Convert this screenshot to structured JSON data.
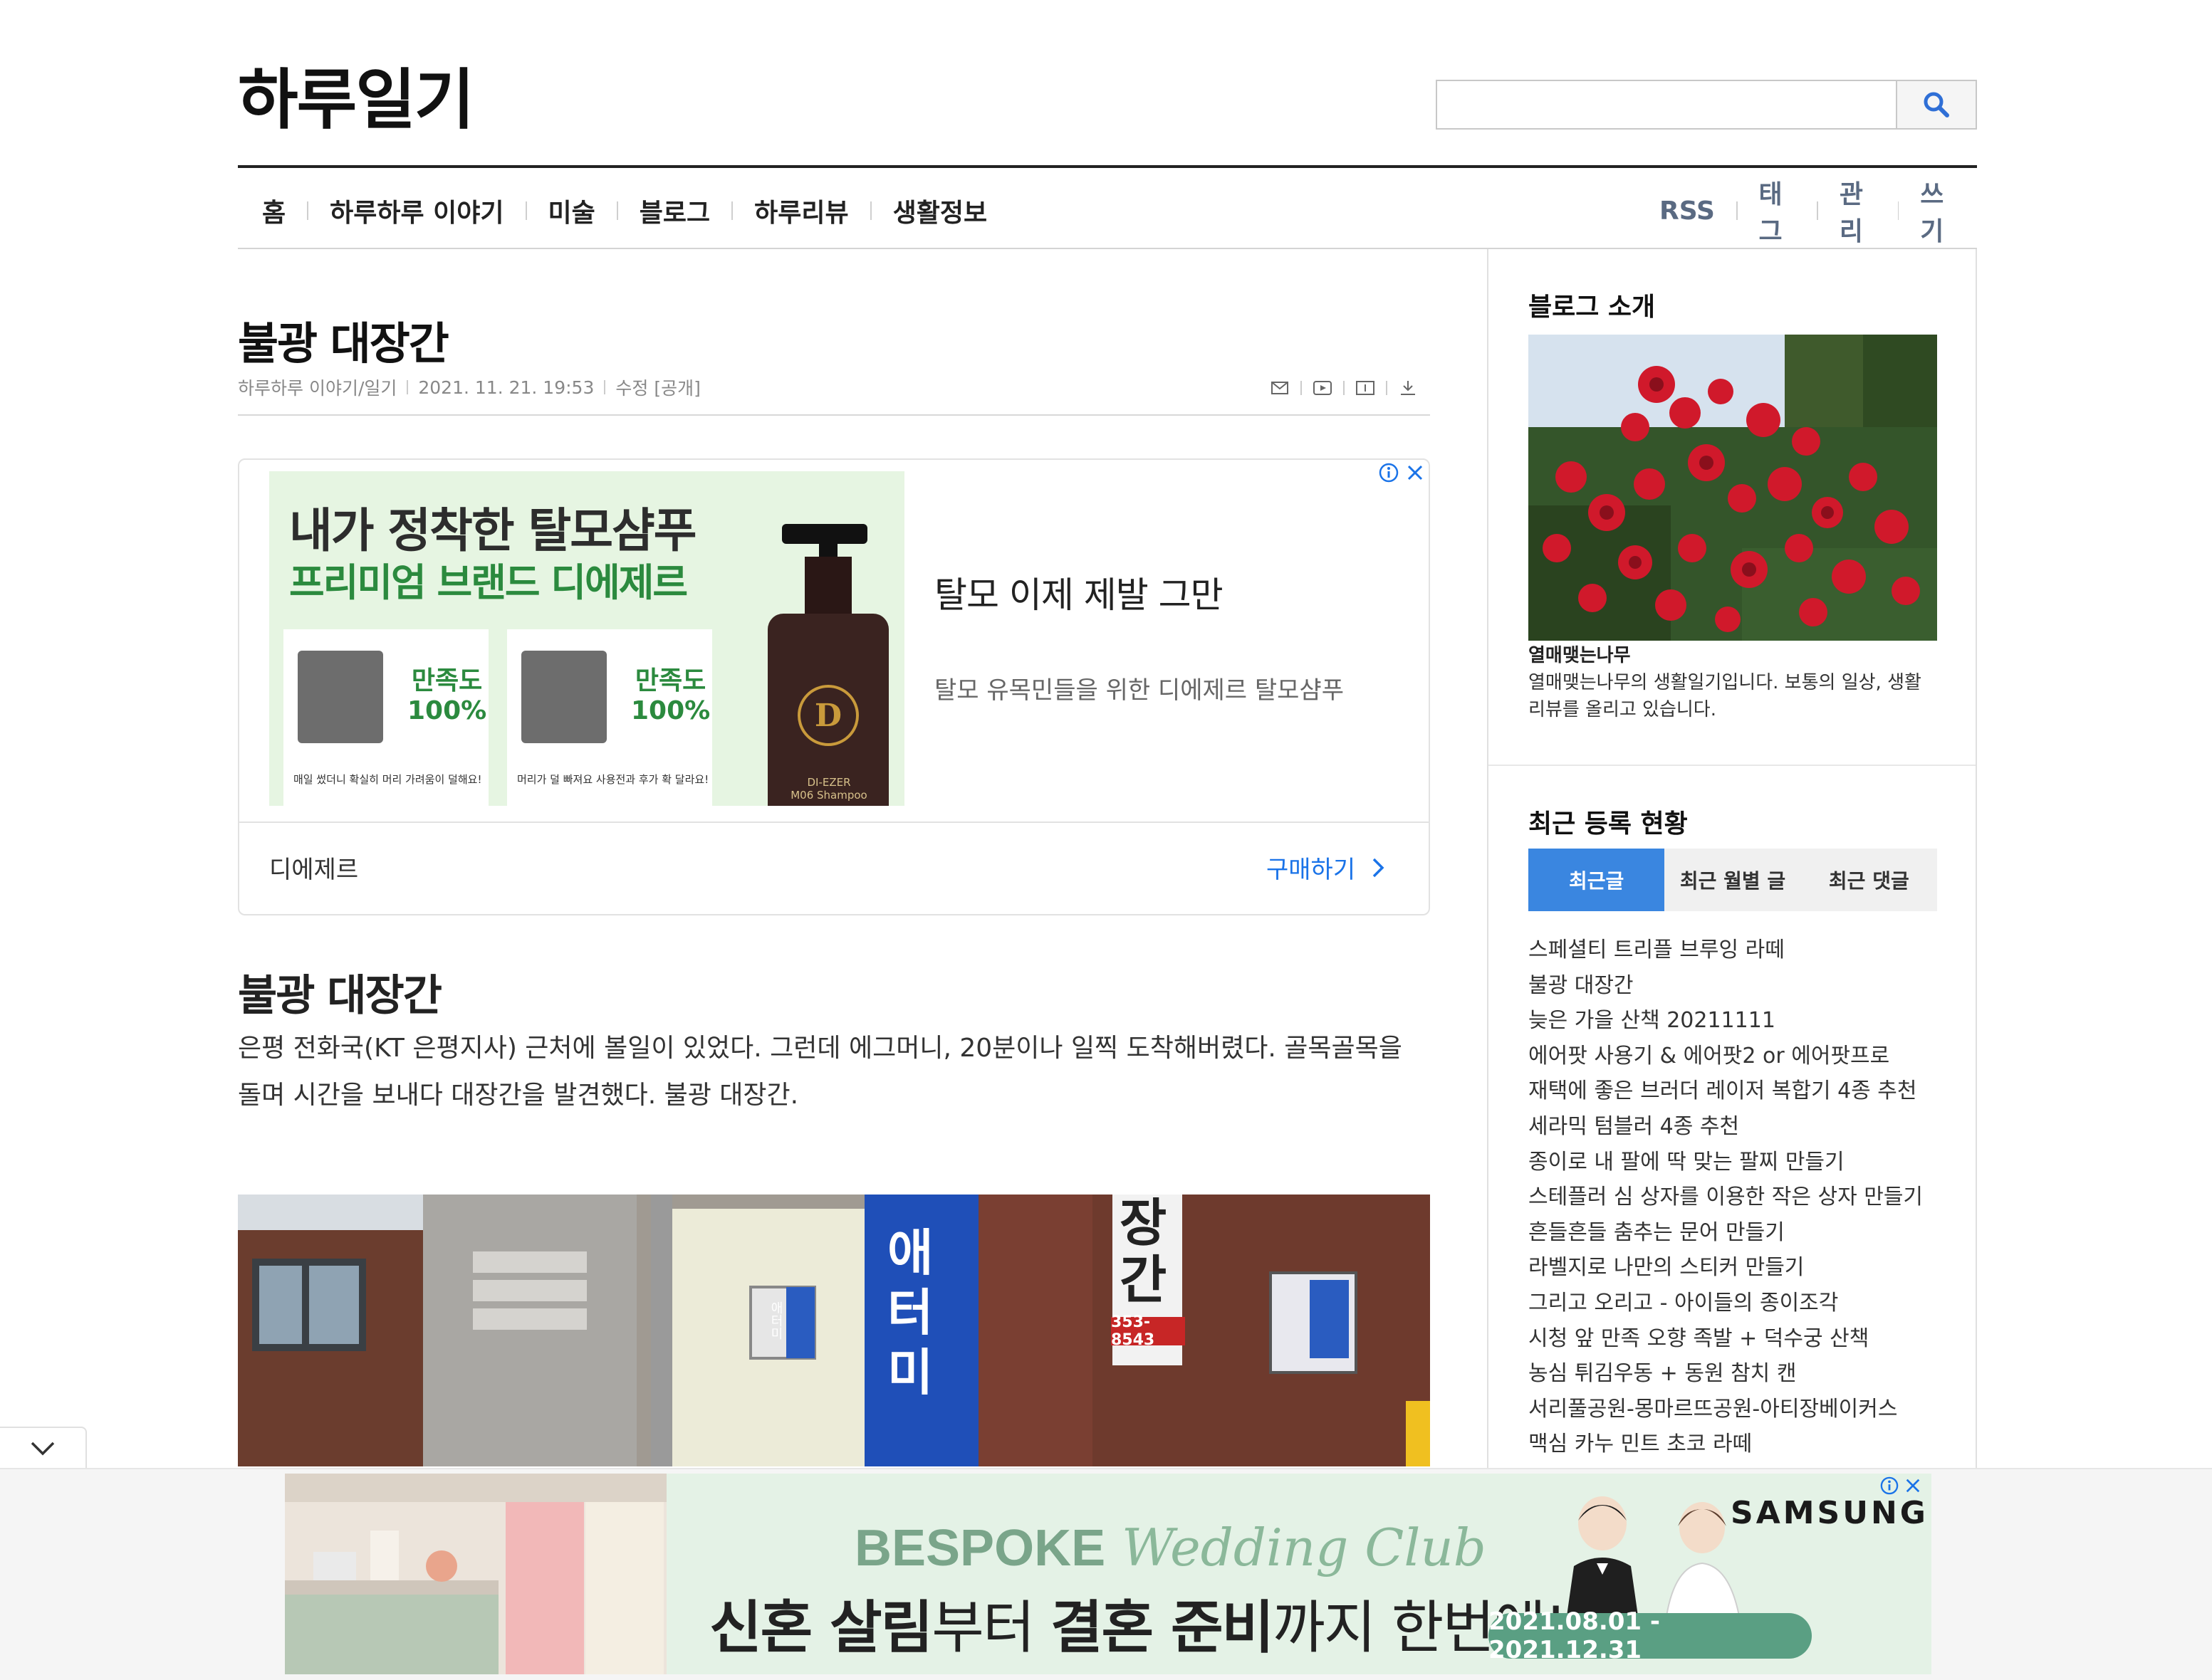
{
  "blog": {
    "title": "하루일기"
  },
  "search": {
    "placeholder": ""
  },
  "nav": {
    "items": [
      "홈",
      "하루하루 이야기",
      "미술",
      "블로그",
      "하루리뷰",
      "생활정보"
    ],
    "util": [
      "RSS",
      "태그",
      "관리",
      "쓰기"
    ]
  },
  "post": {
    "title": "불광 대장간",
    "category": "하루하루 이야기/일기",
    "date": "2021. 11. 21. 19:53",
    "edit": "수정",
    "visibility": "[공개]",
    "subtitle": "불광 대장간",
    "body": "은평 전화국(KT 은평지사) 근처에 볼일이 있었다. 그런데 에그머니, 20분이나 일찍 도착해버렸다. 골목골목을 돌며 시간을 보내다 대장간을 발견했다. 불광 대장간."
  },
  "ad": {
    "headline1": "내가 정착한 탈모샴푸",
    "headline2": "프리미엄 브랜드 디에제르",
    "thumb1_sat": "만족도\n100%",
    "thumb1_caption": "매일 썼더니 확실히 머리 가려움이 덜해요!",
    "thumb2_sat": "만족도\n100%",
    "thumb2_caption": "머리가 덜 빠져요 사용전과 후가 확 달라요!",
    "bottle_logo": "D",
    "bottle_text": "DI-EZER\nM06 Shampoo",
    "title": "탈모 이제 제발 그만",
    "description": "탈모 유목민들을 위한 디에제르 탈모샴푸",
    "brand": "디에제르",
    "cta": "구매하기"
  },
  "sidebar": {
    "intro_heading": "블로그 소개",
    "intro_name": "열매맺는나무",
    "intro_desc": "열매맺는나무의 생활일기입니다. 보통의 일상, 생활 리뷰를 올리고 있습니다.",
    "recent_heading": "최근 등록 현황",
    "tabs": [
      "최근글",
      "최근 월별 글",
      "최근 댓글"
    ],
    "recent_posts": [
      "스페셜티 트리플 브루잉 라떼",
      "불광 대장간",
      "늦은 가을 산책 20211111",
      "에어팟 사용기 & 에어팟2 or 에어팟프로",
      "재택에 좋은 브러더 레이저 복합기 4종 추천",
      "세라믹 텀블러 4종 추천",
      "종이로 내 팔에 딱 맞는 팔찌 만들기",
      "스테플러 심 상자를 이용한 작은 상자 만들기",
      "흔들흔들 춤추는 문어 만들기",
      "라벨지로 나만의 스티커 만들기",
      "그리고 오리고 - 아이들의 종이조각",
      "시청 앞 만족 오향 족발 + 덕수궁 산책",
      "농심 튀김우동 + 동원 참치 캔",
      "서리풀공원-몽마르뜨공원-아티장베이커스",
      "맥심 카누 민트 초코 라떼"
    ]
  },
  "photo": {
    "sign_main": "애\n터\n미",
    "sign_right": "장\n간",
    "sign_phone": "353-8543",
    "window_sign": "애터미"
  },
  "banner": {
    "title_bold": "BESPOKE",
    "title_script": "Wedding Club",
    "main_a": "신혼 살림",
    "main_b": "부터 ",
    "main_c": "결혼 준비",
    "main_d": "까지 한번에!",
    "date": "2021.08.01 - 2021.12.31",
    "brand": "SAMSUNG"
  },
  "colors": {
    "accent": "#3a86e0",
    "util_nav": "#5a6a82",
    "ad_green": "#2b8a3e",
    "cta_blue": "#1a73e8",
    "banner_green": "#5a9f83"
  }
}
